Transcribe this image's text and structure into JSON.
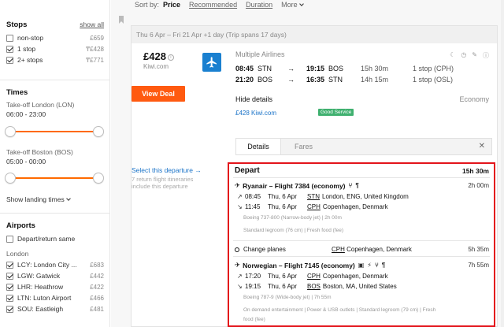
{
  "sidebar": {
    "stops": {
      "title": "Stops",
      "show_all": "show all",
      "items": [
        {
          "label": "non-stop",
          "price": "£659",
          "checked": false
        },
        {
          "label": "1 stop",
          "price": "₸£428",
          "checked": true
        },
        {
          "label": "2+ stops",
          "price": "₸£771",
          "checked": true
        }
      ]
    },
    "times": {
      "title": "Times",
      "takeoff_london_label": "Take-off London (LON)",
      "takeoff_london_range": "06:00 - 23:00",
      "takeoff_boston_label": "Take-off Boston (BOS)",
      "takeoff_boston_range": "05:00 - 00:00",
      "show_landing": "Show landing times"
    },
    "airports": {
      "title": "Airports",
      "same_label": "Depart/return same",
      "group_label": "London",
      "items": [
        {
          "label": "LCY: London City ...",
          "price": "£683",
          "checked": true
        },
        {
          "label": "LGW: Gatwick",
          "price": "£442",
          "checked": true
        },
        {
          "label": "LHR: Heathrow",
          "price": "£422",
          "checked": true
        },
        {
          "label": "LTN: Luton Airport",
          "price": "£466",
          "checked": true
        },
        {
          "label": "SOU: Eastleigh",
          "price": "£481",
          "checked": true
        }
      ]
    }
  },
  "sortbar": {
    "label": "Sort by:",
    "price": "Price",
    "recommended": "Recommended",
    "duration": "Duration",
    "more": "More"
  },
  "result": {
    "date_range": "Thu 6 Apr – Fri 21 Apr +1 day  (Trip spans 17 days)",
    "price": "£428",
    "provider": "Kiwi.com",
    "view_deal": "View Deal",
    "airline": "Multiple Airlines",
    "legs": [
      {
        "dep_time": "08:45",
        "dep_ap": "STN",
        "arr_time": "19:15",
        "arr_ap": "BOS",
        "duration": "15h 30m",
        "stops": "1 stop (CPH)"
      },
      {
        "dep_time": "21:20",
        "dep_ap": "BOS",
        "arr_time": "16:35",
        "arr_ap": "STN",
        "duration": "14h 15m",
        "stops": "1 stop (OSL)"
      }
    ],
    "hide_details": "Hide details",
    "cabin": "Economy",
    "provider_price": "£428 Kiwi.com",
    "good_service": "Good Service",
    "tabs": {
      "details": "Details",
      "fares": "Fares"
    },
    "select_departure": "Select this departure →",
    "select_sub": "7 return flight itineraries include this departure"
  },
  "detail": {
    "title": "Depart",
    "total_duration": "15h 30m",
    "flight1": {
      "title": "Ryanair – Flight 7384 (economy)",
      "duration": "2h 00m",
      "dep": {
        "time": "08:45",
        "date": "Thu, 6 Apr",
        "code": "STN",
        "place": "London, ENG, United Kingdom"
      },
      "arr": {
        "time": "11:45",
        "date": "Thu, 6 Apr",
        "code": "CPH",
        "place": "Copenhagen, Denmark"
      },
      "aircraft": "Boeing 737-800 (Narrow-body jet)  |  2h 00m",
      "amenities": "Standard legroom (76 cm)   |   Fresh food (fee)"
    },
    "change": {
      "label": "Change planes",
      "code": "CPH",
      "place": "Copenhagen, Denmark",
      "duration": "5h 35m"
    },
    "flight2": {
      "title": "Norwegian – Flight 7145 (economy)",
      "duration": "7h 55m",
      "dep": {
        "time": "17:20",
        "date": "Thu, 6 Apr",
        "code": "CPH",
        "place": "Copenhagen, Denmark"
      },
      "arr": {
        "time": "19:15",
        "date": "Thu, 6 Apr",
        "code": "BOS",
        "place": "Boston, MA, United States"
      },
      "aircraft": "Boeing 787-9 (Wide-body jet)  |  7h 55m",
      "amenities": "On demand entertainment   |   Power & USB outlets   |   Standard legroom (79 cm)   |   Fresh",
      "amenities2": "food (fee)"
    }
  },
  "colors": {
    "accent": "#ff5a10",
    "link": "#1a73c8",
    "highlight": "#e3141b",
    "good": "#3fb06f"
  }
}
